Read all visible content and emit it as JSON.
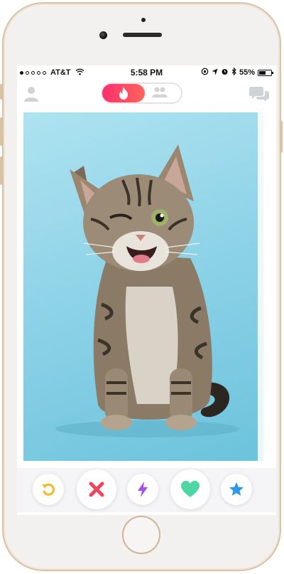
{
  "status_bar": {
    "carrier": "AT&T",
    "time": "5:58 PM",
    "battery_percent": "55%",
    "battery_level": 0.55,
    "signal_bars_filled": 1,
    "signal_bars_total": 5
  },
  "top_nav": {
    "active_tab": "discover",
    "tabs": [
      "discover",
      "social"
    ]
  },
  "card": {
    "photo_description_icon": "winking-kitten-photo"
  },
  "actions": [
    {
      "name": "rewind",
      "icon": "rewind-icon",
      "color": "#f5b81f"
    },
    {
      "name": "nope",
      "icon": "close-icon",
      "color": "#f0445f"
    },
    {
      "name": "boost",
      "icon": "lightning-icon",
      "color": "#a54ef0"
    },
    {
      "name": "like",
      "icon": "heart-icon",
      "color": "#4ed6a4"
    },
    {
      "name": "super-like",
      "icon": "star-icon",
      "color": "#2d9ae9"
    }
  ],
  "colors": {
    "brand_gradient_start": "#fd2f6f",
    "brand_gradient_end": "#ff655b",
    "frame": "#d9c3a6"
  }
}
